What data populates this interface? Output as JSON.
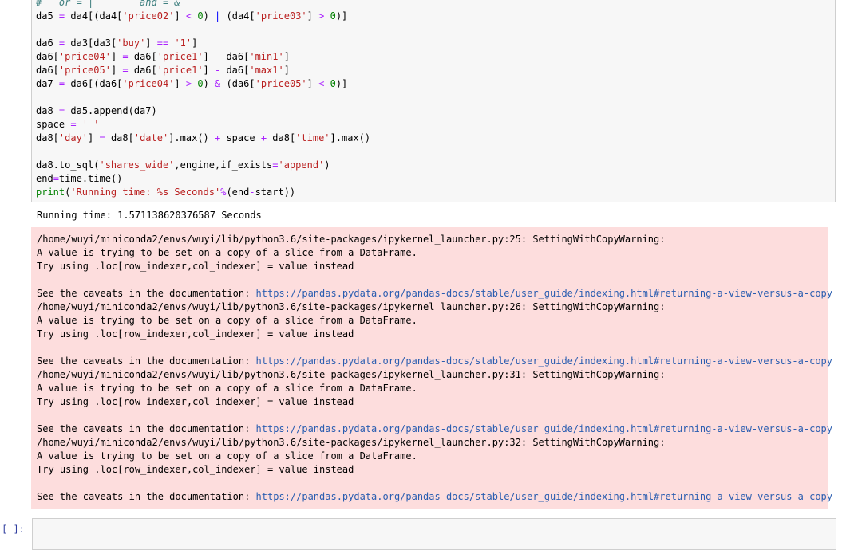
{
  "code": {
    "comment": "#   or = |        and = &",
    "l1": [
      "da5 ",
      "=",
      " da4[(da4[",
      "'price02'",
      "] ",
      "<",
      " ",
      "0",
      ") ",
      "|",
      " (da4[",
      "'price03'",
      "] ",
      ">",
      " ",
      "0",
      ")]"
    ],
    "l2": [
      "da6 ",
      "=",
      " da3[da3[",
      "'buy'",
      "] ",
      "==",
      " ",
      "'1'",
      "]"
    ],
    "l3": [
      "da6[",
      "'price04'",
      "] ",
      "=",
      " da6[",
      "'price1'",
      "] ",
      "-",
      " da6[",
      "'min1'",
      "]"
    ],
    "l4": [
      "da6[",
      "'price05'",
      "] ",
      "=",
      " da6[",
      "'price1'",
      "] ",
      "-",
      " da6[",
      "'max1'",
      "]"
    ],
    "l5": [
      "da7 ",
      "=",
      " da6[(da6[",
      "'price04'",
      "] ",
      ">",
      " ",
      "0",
      ") ",
      "&",
      " (da6[",
      "'price05'",
      "] ",
      "<",
      " ",
      "0",
      ")]"
    ],
    "l6": [
      "da8 ",
      "=",
      " da5.append(da7)"
    ],
    "l7": [
      "space ",
      "=",
      " ",
      "' '"
    ],
    "l8": [
      "da8[",
      "'day'",
      "] ",
      "=",
      " da8[",
      "'date'",
      "].max() ",
      "+",
      " space ",
      "+",
      " da8[",
      "'time'",
      "].max()"
    ],
    "l9": [
      "da8.to_sql(",
      "'shares_wide'",
      ",engine,if_exists",
      "=",
      "'append'",
      ")"
    ],
    "l10": [
      "end",
      "=",
      "time.time()"
    ],
    "l11": [
      "print",
      "(",
      "'Running time: %s Seconds'",
      "%",
      "(end",
      "-",
      "start))"
    ]
  },
  "output": {
    "stdout": "Running time: 1.571138620376587 Seconds",
    "warnings": [
      {
        "path": "/home/wuyi/miniconda2/envs/wuyi/lib/python3.6/site-packages/ipykernel_launcher.py:25: SettingWithCopyWarning:"
      },
      {
        "path": "/home/wuyi/miniconda2/envs/wuyi/lib/python3.6/site-packages/ipykernel_launcher.py:26: SettingWithCopyWarning:"
      },
      {
        "path": "/home/wuyi/miniconda2/envs/wuyi/lib/python3.6/site-packages/ipykernel_launcher.py:31: SettingWithCopyWarning:"
      },
      {
        "path": "/home/wuyi/miniconda2/envs/wuyi/lib/python3.6/site-packages/ipykernel_launcher.py:32: SettingWithCopyWarning:"
      }
    ],
    "msg1": "A value is trying to be set on a copy of a slice from a DataFrame.",
    "msg2": "Try using .loc[row_indexer,col_indexer] = value instead",
    "caveat": "See the caveats in the documentation: ",
    "link": "https://pandas.pydata.org/pandas-docs/stable/user_guide/indexing.html#returning-a-view-versus-a-copy"
  },
  "prompt": "[ ]:",
  "colors": {
    "stderr_bg": "#fddddd",
    "cell_bg": "#f7f7f7",
    "link": "#2a5db0"
  }
}
